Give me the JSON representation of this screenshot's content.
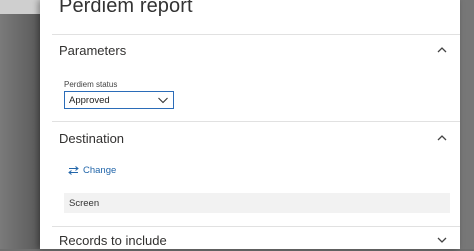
{
  "dialog": {
    "title": "Perdiem report"
  },
  "parameters": {
    "section_title": "Parameters",
    "perdiem_status": {
      "label": "Perdiem status",
      "value": "Approved"
    }
  },
  "destination": {
    "section_title": "Destination",
    "change_label": "Change",
    "value": "Screen"
  },
  "records": {
    "section_title": "Records to include"
  },
  "icons": {
    "parameters_toggle": "chevron-up-icon",
    "destination_toggle": "chevron-up-icon",
    "records_toggle": "chevron-down-icon",
    "select_toggle": "chevron-down-icon",
    "change": "swap-arrows-icon"
  },
  "colors": {
    "accent": "#2266aa",
    "select_border": "#2b6cb8",
    "field_background": "#f2f2f2"
  }
}
